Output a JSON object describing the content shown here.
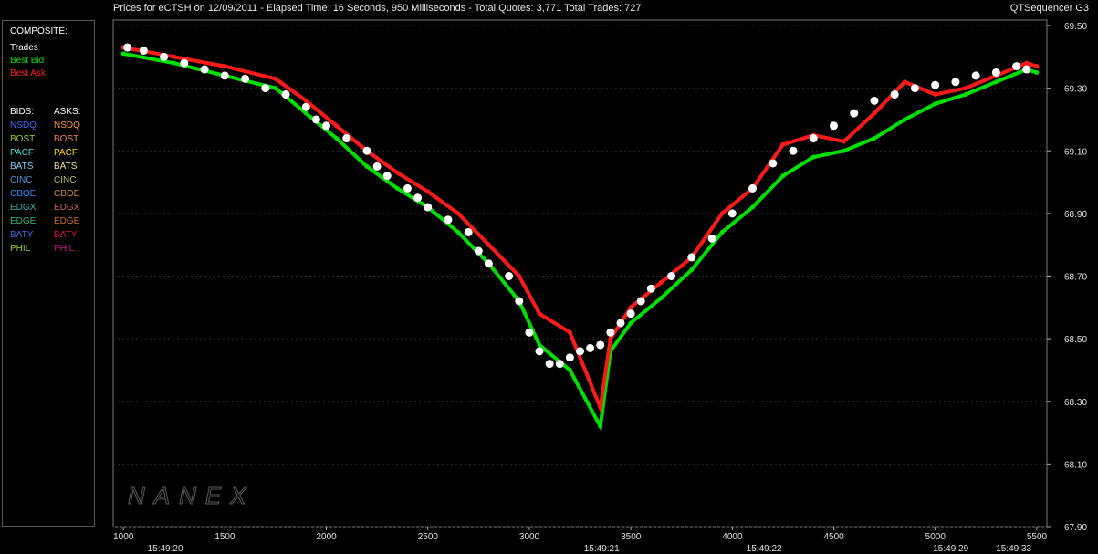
{
  "header": {
    "title": "Prices for  eCTSH  on  12/09/2011  -  Elapsed Time: 16 Seconds, 950 Milliseconds  -  Total Quotes: 3,771  Total Trades: 727",
    "app": "QTSequencer G3"
  },
  "legend": {
    "composite_label": "COMPOSITE:",
    "trades": "Trades",
    "best_bid": "Best Bid",
    "best_ask": "Best Ask",
    "bids_label": "BIDS:",
    "asks_label": "ASKS:",
    "exchanges": [
      {
        "bid": "NSDQ",
        "ask": "NSDQ",
        "bid_color": "#3a6bff",
        "ask_color": "#ff9a30"
      },
      {
        "bid": "BOST",
        "ask": "BOST",
        "bid_color": "#9acd32",
        "ask_color": "#ff7f50"
      },
      {
        "bid": "PACF",
        "ask": "PACF",
        "bid_color": "#40e0d0",
        "ask_color": "#ffd700"
      },
      {
        "bid": "BATS",
        "ask": "BATS",
        "bid_color": "#87cefa",
        "ask_color": "#f0e68c"
      },
      {
        "bid": "CINC",
        "ask": "CINC",
        "bid_color": "#4f94cd",
        "ask_color": "#bdb76b"
      },
      {
        "bid": "CBOE",
        "ask": "CBOE",
        "bid_color": "#1e90ff",
        "ask_color": "#cd853f"
      },
      {
        "bid": "EDGX",
        "ask": "EDGX",
        "bid_color": "#20b2aa",
        "ask_color": "#cd5c5c"
      },
      {
        "bid": "EDGE",
        "ask": "EDGE",
        "bid_color": "#3cb371",
        "ask_color": "#d2691e"
      },
      {
        "bid": "BATY",
        "ask": "BATY",
        "bid_color": "#4169e1",
        "ask_color": "#dc143c"
      },
      {
        "bid": "PHIL",
        "ask": "PHIL",
        "bid_color": "#9acd32",
        "ask_color": "#c71585"
      }
    ]
  },
  "watermark": "NANEX",
  "colors": {
    "trade": "#ffffff",
    "best_bid": "#00e000",
    "best_ask": "#ff1a1a",
    "grid": "#2a2a2a"
  },
  "chart_data": {
    "type": "scatter",
    "title": "Prices for  eCTSH  on  12/09/2011",
    "xlabel": "",
    "ylabel": "",
    "xlim": [
      950,
      5550
    ],
    "ylim": [
      67.9,
      69.5
    ],
    "y_ticks": [
      "67.90",
      "68.10",
      "68.30",
      "68.50",
      "68.70",
      "68.90",
      "69.10",
      "69.30",
      "69.50"
    ],
    "x_ticks": [
      1000,
      1500,
      2000,
      2500,
      3000,
      3500,
      4000,
      4500,
      5000,
      5500
    ],
    "time_labels": [
      {
        "x": 1200,
        "label": "15:49:20"
      },
      {
        "x": 3350,
        "label": "15:49:21"
      },
      {
        "x": 4150,
        "label": "15:49:22"
      },
      {
        "x": 5070,
        "label": "15:49:29"
      },
      {
        "x": 5380,
        "label": "15:49:33"
      }
    ],
    "series": [
      {
        "name": "Best Bid",
        "x": [
          1000,
          1250,
          1500,
          1750,
          1900,
          2050,
          2200,
          2350,
          2500,
          2650,
          2800,
          2950,
          3050,
          3200,
          3350,
          3400,
          3500,
          3650,
          3800,
          3950,
          4100,
          4250,
          4400,
          4550,
          4700,
          4850,
          5000,
          5150,
          5300,
          5450,
          5500
        ],
        "y": [
          69.41,
          69.38,
          69.34,
          69.3,
          69.22,
          69.14,
          69.05,
          68.98,
          68.92,
          68.84,
          68.74,
          68.62,
          68.48,
          68.4,
          68.22,
          68.46,
          68.55,
          68.63,
          68.72,
          68.84,
          68.92,
          69.02,
          69.08,
          69.1,
          69.14,
          69.2,
          69.25,
          69.28,
          69.32,
          69.36,
          69.35
        ]
      },
      {
        "name": "Best Ask",
        "x": [
          1000,
          1250,
          1500,
          1750,
          1900,
          2050,
          2200,
          2350,
          2500,
          2650,
          2800,
          2950,
          3050,
          3200,
          3350,
          3400,
          3500,
          3650,
          3800,
          3950,
          4100,
          4250,
          4400,
          4550,
          4700,
          4850,
          5000,
          5150,
          5300,
          5450,
          5500
        ],
        "y": [
          69.43,
          69.4,
          69.37,
          69.33,
          69.26,
          69.18,
          69.1,
          69.03,
          68.97,
          68.9,
          68.8,
          68.7,
          68.58,
          68.52,
          68.28,
          68.5,
          68.6,
          68.68,
          68.76,
          68.9,
          68.98,
          69.12,
          69.15,
          69.13,
          69.22,
          69.32,
          69.28,
          69.3,
          69.34,
          69.38,
          69.37
        ]
      },
      {
        "name": "Trades",
        "x": [
          1020,
          1100,
          1200,
          1300,
          1400,
          1500,
          1600,
          1700,
          1800,
          1900,
          1950,
          2000,
          2100,
          2200,
          2250,
          2300,
          2400,
          2450,
          2500,
          2600,
          2700,
          2750,
          2800,
          2900,
          2950,
          3000,
          3050,
          3100,
          3150,
          3200,
          3250,
          3300,
          3350,
          3400,
          3450,
          3500,
          3550,
          3600,
          3700,
          3800,
          3900,
          4000,
          4100,
          4200,
          4300,
          4400,
          4500,
          4600,
          4700,
          4800,
          4900,
          5000,
          5100,
          5200,
          5300,
          5400,
          5450
        ],
        "y": [
          69.43,
          69.42,
          69.4,
          69.38,
          69.36,
          69.34,
          69.33,
          69.3,
          69.28,
          69.24,
          69.2,
          69.18,
          69.14,
          69.1,
          69.05,
          69.02,
          68.98,
          68.95,
          68.92,
          68.88,
          68.84,
          68.78,
          68.74,
          68.7,
          68.62,
          68.52,
          68.46,
          68.42,
          68.42,
          68.44,
          68.46,
          68.47,
          68.48,
          68.52,
          68.55,
          68.58,
          68.62,
          68.66,
          68.7,
          68.76,
          68.82,
          68.9,
          68.98,
          69.06,
          69.1,
          69.14,
          69.18,
          69.22,
          69.26,
          69.28,
          69.3,
          69.31,
          69.32,
          69.34,
          69.35,
          69.37,
          69.36
        ]
      }
    ]
  }
}
